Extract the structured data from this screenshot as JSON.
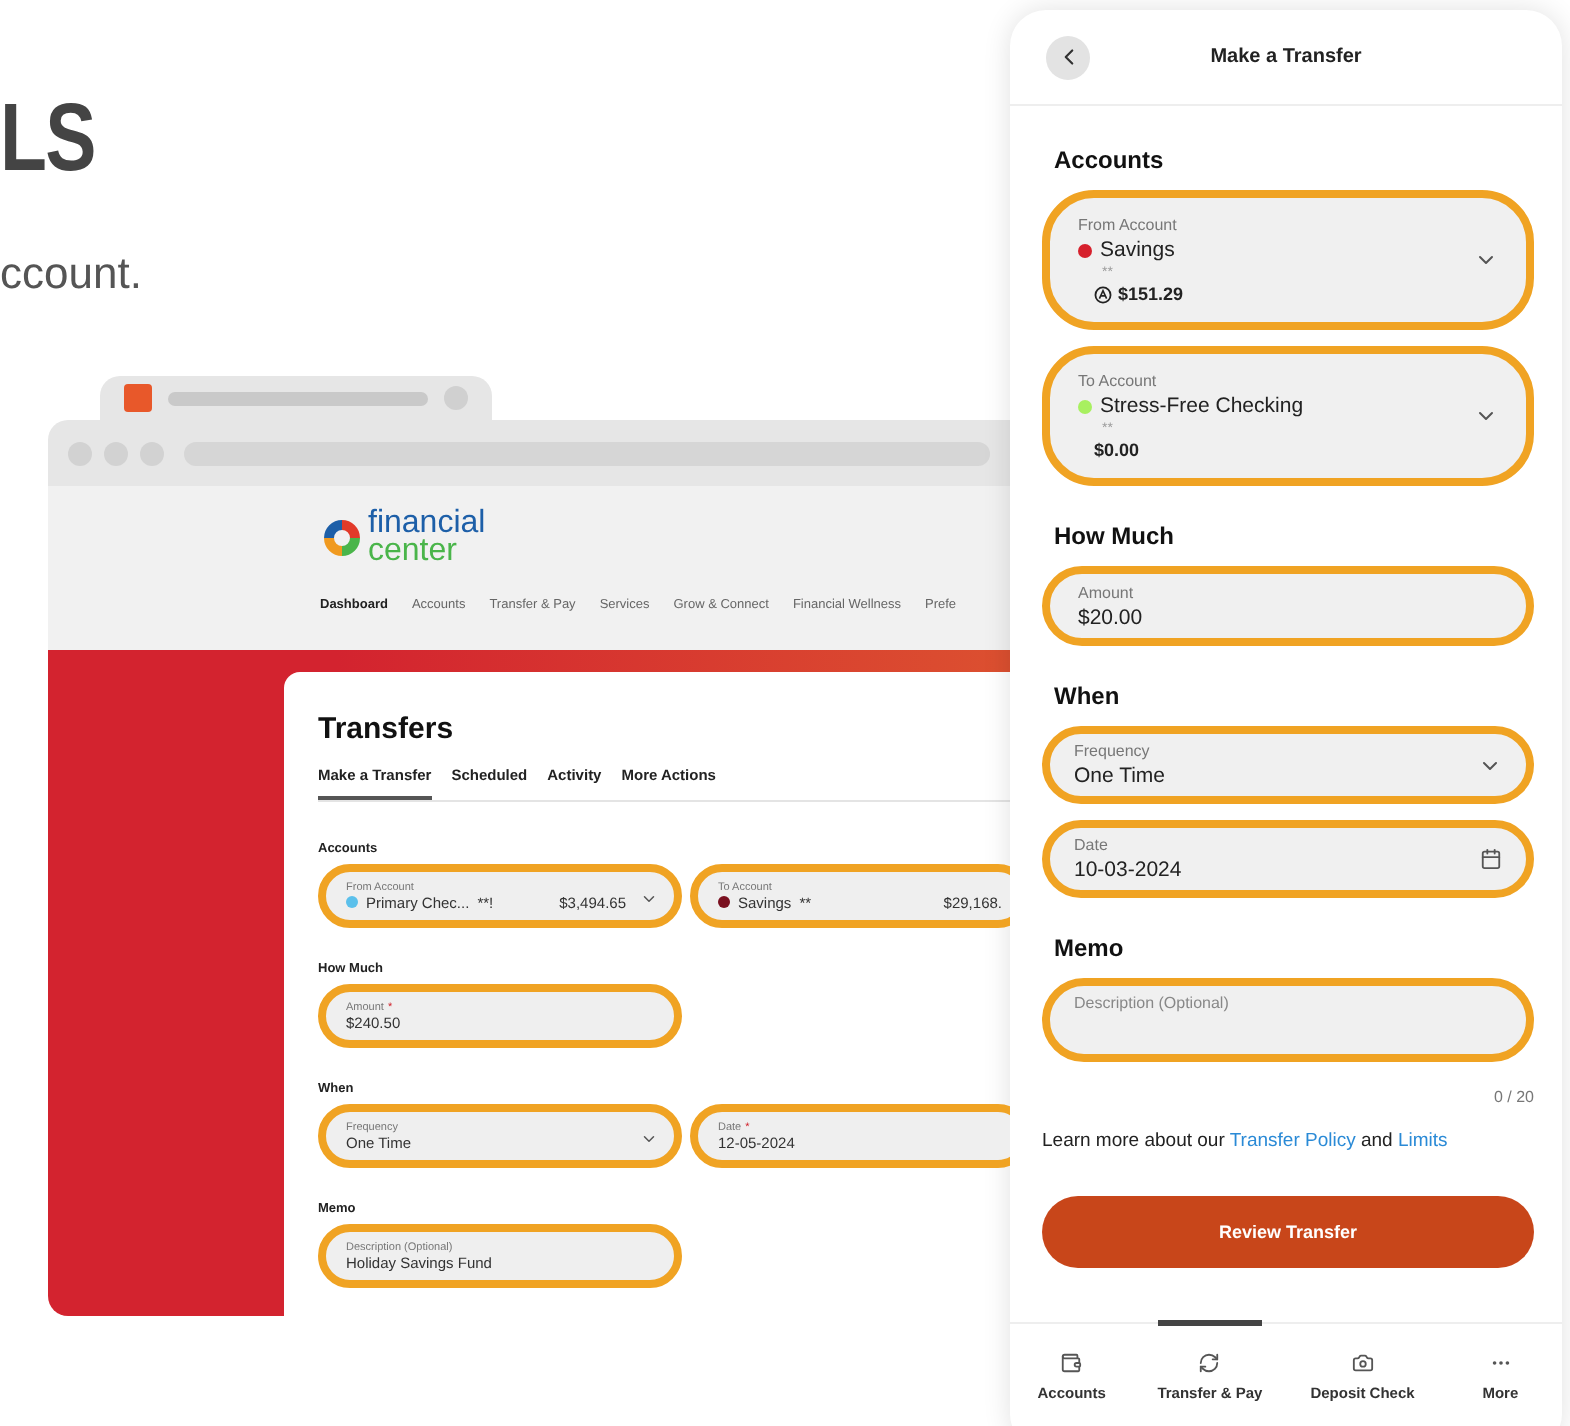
{
  "heading": "LS",
  "subtitle": "ccount.",
  "browser": {
    "logo": {
      "line1": "financial",
      "line2": "center"
    },
    "nav": [
      {
        "label": "Dashboard",
        "selected": true
      },
      {
        "label": "Accounts",
        "selected": false
      },
      {
        "label": "Transfer & Pay",
        "selected": false
      },
      {
        "label": "Services",
        "selected": false
      },
      {
        "label": "Grow & Connect",
        "selected": false
      },
      {
        "label": "Financial Wellness",
        "selected": false
      },
      {
        "label": "Prefe",
        "selected": false
      }
    ],
    "title": "Transfers",
    "tabs": [
      {
        "label": "Make a Transfer",
        "selected": true
      },
      {
        "label": "Scheduled",
        "selected": false
      },
      {
        "label": "Activity",
        "selected": false
      },
      {
        "label": "More Actions",
        "selected": false
      }
    ],
    "sections": [
      {
        "title": "Accounts",
        "fields": [
          {
            "kind": "account",
            "label": "From Account",
            "name": "Primary Chec...",
            "mask": "**!",
            "balance": "$3,494.65",
            "color": "#5bc0eb",
            "dropdown": true,
            "highlighted": true
          },
          {
            "kind": "account",
            "label": "To Account",
            "name": "Savings",
            "mask": "**",
            "balance": "$29,168.",
            "color": "#7a1020",
            "dropdown": false,
            "highlighted": true
          }
        ]
      },
      {
        "title": "How Much",
        "fields": [
          {
            "kind": "text",
            "label": "Amount",
            "mark": "*",
            "value": "$240.50",
            "highlighted": true
          }
        ]
      },
      {
        "title": "When",
        "fields": [
          {
            "kind": "select",
            "label": "Frequency",
            "value": "One Time",
            "highlighted": true
          },
          {
            "kind": "text",
            "label": "Date",
            "mark": "*",
            "value": "12-05-2024",
            "highlighted": true
          }
        ]
      },
      {
        "title": "Memo",
        "fields": [
          {
            "kind": "memo",
            "label": "Description (Optional)",
            "value": "Holiday Savings Fund",
            "highlighted": true
          }
        ]
      }
    ]
  },
  "phone": {
    "title": "Make a Transfer",
    "sections": [
      {
        "title": "Accounts",
        "fields": [
          {
            "kind": "account",
            "label": "From Account",
            "name": "Savings",
            "mask": "**",
            "balance": "$151.29",
            "balance_icon": true,
            "color": "#d6202c",
            "highlighted": true
          },
          {
            "kind": "account",
            "label": "To Account",
            "name": "Stress-Free Checking",
            "mask": "**",
            "balance": "$0.00",
            "balance_icon": false,
            "color": "#a8f060",
            "highlighted": true
          }
        ]
      },
      {
        "title": "How Much",
        "fields": [
          {
            "kind": "text",
            "label": "Amount",
            "value": "$20.00",
            "highlighted": true
          }
        ]
      },
      {
        "title": "When",
        "fields": [
          {
            "kind": "select",
            "label": "Frequency",
            "value": "One Time",
            "highlighted": true
          },
          {
            "kind": "date",
            "label": "Date",
            "value": "10-03-2024",
            "highlighted": true
          }
        ]
      },
      {
        "title": "Memo",
        "fields": [
          {
            "kind": "memo",
            "placeholder": "Description (Optional)",
            "counter": "0 / 20",
            "highlighted": true
          }
        ]
      }
    ],
    "info": [
      {
        "text": "Learn more about our ",
        "link": false
      },
      {
        "text": "Transfer Policy",
        "link": true
      },
      {
        "text": " and ",
        "link": false
      },
      {
        "text": "Limits",
        "link": true
      }
    ],
    "button": "Review Transfer",
    "nav": [
      {
        "label": "Accounts",
        "selected": false
      },
      {
        "label": "Transfer & Pay",
        "selected": true
      },
      {
        "label": "Deposit Check",
        "selected": false
      },
      {
        "label": "More",
        "selected": false
      }
    ]
  }
}
